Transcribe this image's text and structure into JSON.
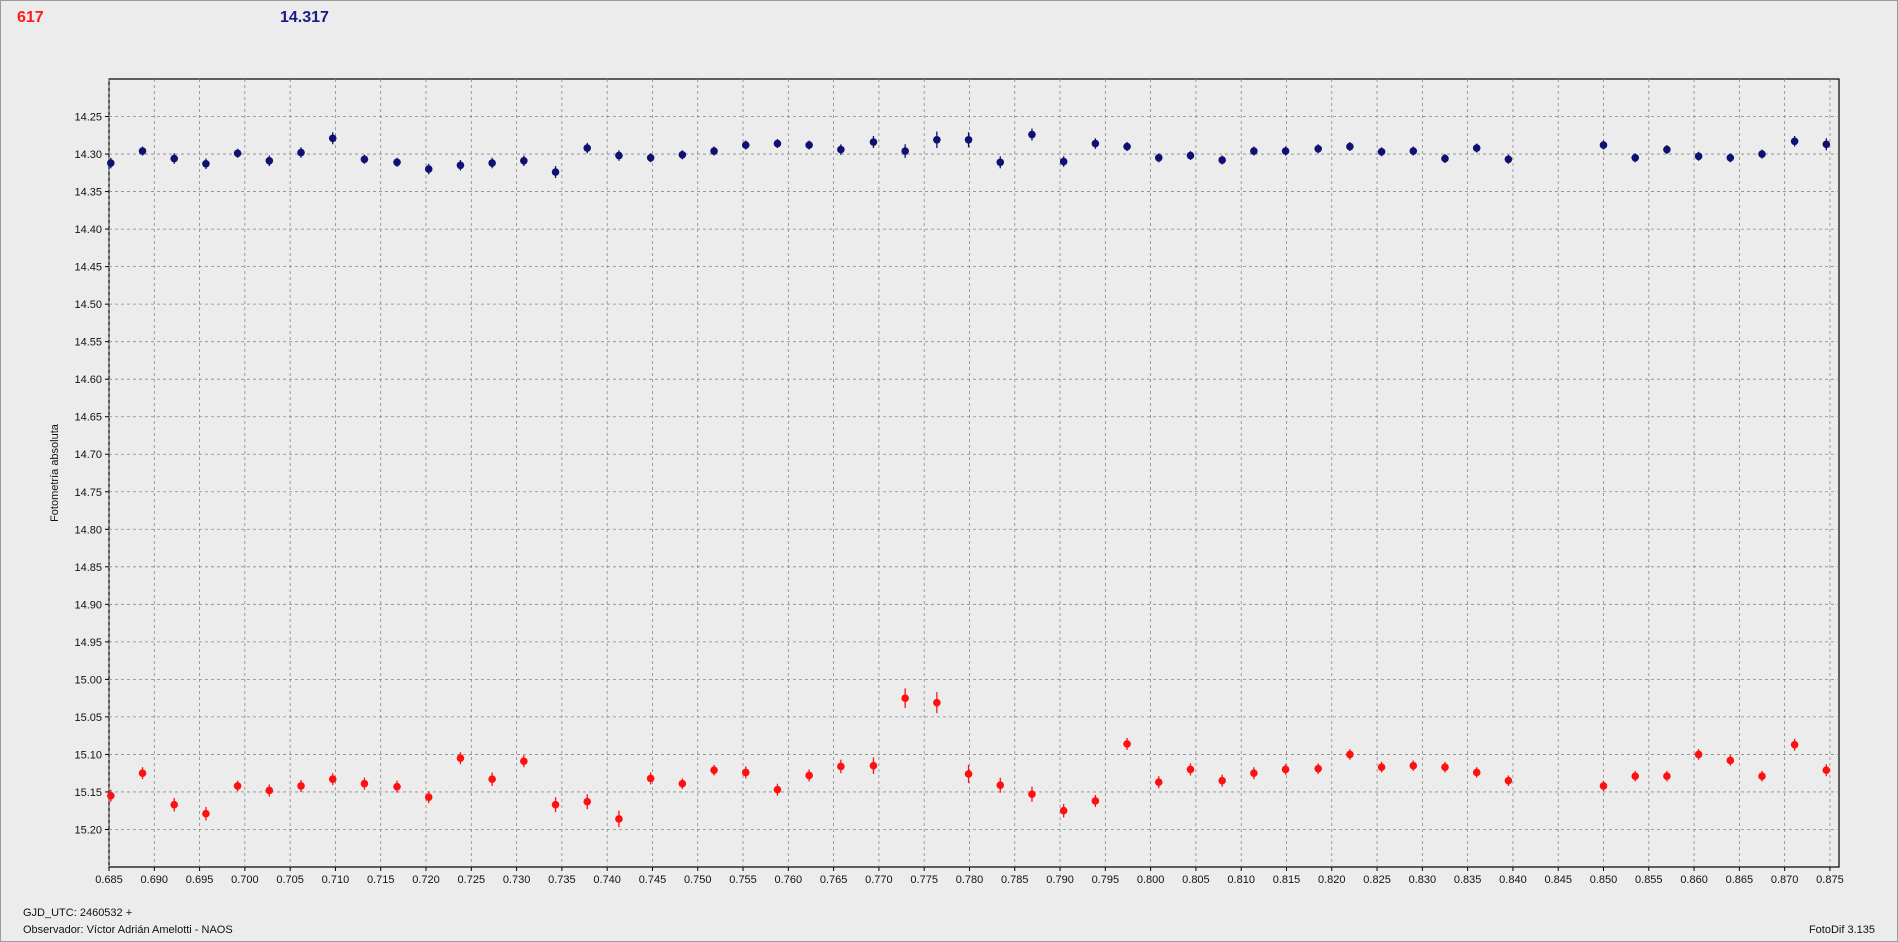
{
  "header": {
    "readout_left": "617",
    "readout_right": "14.317"
  },
  "footer": {
    "gjd": "GJD_UTC: 2460532 +",
    "observer": "Observador: Víctor Adrián Amelotti - NAOS",
    "version": "FotoDif 3.135"
  },
  "colors": {
    "series_top": "#101070",
    "series_bottom": "#ff1010",
    "readout_left": "#ff1a1a",
    "readout_right": "#1a1a8c",
    "grid": "#888888",
    "plot_background": "#ececec"
  },
  "chart_data": {
    "type": "scatter",
    "title": "",
    "xlabel": "",
    "ylabel": "Fotometría absoluta",
    "xlim": [
      0.685,
      0.876
    ],
    "ylim": [
      14.2,
      15.25
    ],
    "y_inverted": true,
    "grid": true,
    "legend": "none",
    "x_ticks": [
      "0.685",
      "0.690",
      "0.695",
      "0.700",
      "0.705",
      "0.710",
      "0.715",
      "0.720",
      "0.725",
      "0.730",
      "0.735",
      "0.740",
      "0.745",
      "0.750",
      "0.755",
      "0.760",
      "0.765",
      "0.770",
      "0.775",
      "0.780",
      "0.785",
      "0.790",
      "0.795",
      "0.800",
      "0.805",
      "0.810",
      "0.815",
      "0.820",
      "0.825",
      "0.830",
      "0.835",
      "0.840",
      "0.845",
      "0.850",
      "0.855",
      "0.860",
      "0.865",
      "0.870",
      "0.875"
    ],
    "y_ticks": [
      "14.25",
      "14.30",
      "14.35",
      "14.40",
      "14.45",
      "14.50",
      "14.55",
      "14.60",
      "14.65",
      "14.70",
      "14.75",
      "14.80",
      "14.85",
      "14.90",
      "14.95",
      "15.00",
      "15.05",
      "15.10",
      "15.15",
      "15.20"
    ],
    "x": [
      0.6852,
      0.6887,
      0.6922,
      0.6957,
      0.6992,
      0.7027,
      0.7062,
      0.7097,
      0.7132,
      0.7168,
      0.7203,
      0.7238,
      0.7273,
      0.7308,
      0.7343,
      0.7378,
      0.7413,
      0.7448,
      0.7483,
      0.7518,
      0.7553,
      0.7588,
      0.7623,
      0.7658,
      0.7694,
      0.7729,
      0.7764,
      0.7799,
      0.7834,
      0.7869,
      0.7904,
      0.7939,
      0.7974,
      0.8009,
      0.8044,
      0.8079,
      0.8114,
      0.8149,
      0.8185,
      0.822,
      0.8255,
      0.829,
      0.8325,
      0.836,
      0.8395,
      0.85,
      0.8535,
      0.857,
      0.8605,
      0.864,
      0.8675,
      0.8711,
      0.8746
    ],
    "series": [
      {
        "color": "#101070",
        "values": [
          14.312,
          14.296,
          14.306,
          14.313,
          14.299,
          14.309,
          14.298,
          14.279,
          14.307,
          14.311,
          14.32,
          14.315,
          14.312,
          14.309,
          14.324,
          14.292,
          14.302,
          14.305,
          14.301,
          14.296,
          14.288,
          14.286,
          14.288,
          14.294,
          14.284,
          14.296,
          14.281,
          14.281,
          14.311,
          14.274,
          14.31,
          14.286,
          14.29,
          14.305,
          14.302,
          14.308,
          14.296,
          14.296,
          14.293,
          14.29,
          14.297,
          14.296,
          14.306,
          14.292,
          14.307,
          14.288,
          14.305,
          14.294,
          14.303,
          14.305,
          14.3,
          14.283,
          14.287
        ],
        "errors": [
          0.007,
          0.006,
          0.007,
          0.007,
          0.006,
          0.007,
          0.007,
          0.008,
          0.006,
          0.006,
          0.007,
          0.007,
          0.007,
          0.007,
          0.008,
          0.007,
          0.007,
          0.006,
          0.006,
          0.006,
          0.006,
          0.006,
          0.006,
          0.007,
          0.008,
          0.009,
          0.011,
          0.01,
          0.008,
          0.008,
          0.007,
          0.007,
          0.006,
          0.006,
          0.006,
          0.006,
          0.006,
          0.006,
          0.006,
          0.006,
          0.006,
          0.006,
          0.006,
          0.006,
          0.006,
          0.006,
          0.006,
          0.006,
          0.006,
          0.006,
          0.006,
          0.007,
          0.008
        ]
      },
      {
        "color": "#ff1010",
        "values": [
          15.155,
          15.125,
          15.167,
          15.179,
          15.142,
          15.148,
          15.142,
          15.133,
          15.139,
          15.143,
          15.157,
          15.105,
          15.133,
          15.109,
          15.167,
          15.163,
          15.186,
          15.132,
          15.139,
          15.121,
          15.124,
          15.147,
          15.128,
          15.116,
          15.115,
          15.025,
          15.031,
          15.126,
          15.141,
          15.153,
          15.175,
          15.162,
          15.086,
          15.137,
          15.12,
          15.135,
          15.125,
          15.12,
          15.119,
          15.1,
          15.117,
          15.115,
          15.117,
          15.124,
          15.135,
          15.142,
          15.129,
          15.129,
          15.1,
          15.108,
          15.129,
          15.087,
          15.121
        ],
        "errors": [
          0.008,
          0.008,
          0.009,
          0.009,
          0.007,
          0.008,
          0.008,
          0.008,
          0.008,
          0.008,
          0.008,
          0.008,
          0.009,
          0.008,
          0.01,
          0.01,
          0.011,
          0.008,
          0.007,
          0.007,
          0.008,
          0.008,
          0.008,
          0.009,
          0.011,
          0.013,
          0.014,
          0.012,
          0.01,
          0.01,
          0.009,
          0.008,
          0.008,
          0.008,
          0.008,
          0.008,
          0.008,
          0.007,
          0.007,
          0.007,
          0.007,
          0.007,
          0.007,
          0.007,
          0.007,
          0.007,
          0.007,
          0.007,
          0.007,
          0.007,
          0.007,
          0.008,
          0.008
        ]
      }
    ]
  }
}
